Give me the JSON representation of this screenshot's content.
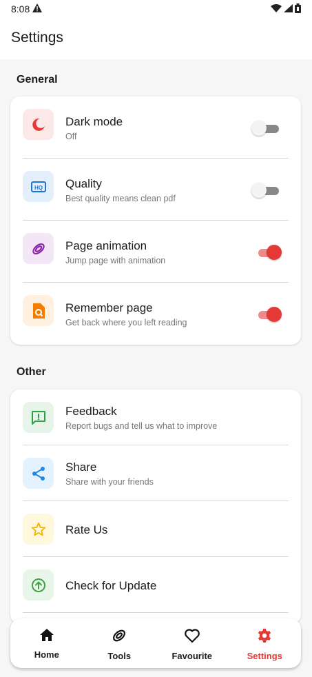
{
  "status": {
    "time": "8:08"
  },
  "header": {
    "title": "Settings"
  },
  "general": {
    "title": "General",
    "items": [
      {
        "label": "Dark mode",
        "subtitle": "Off",
        "icon": "moon-icon",
        "icon_color": "#e53935",
        "icon_bg": "#fde8e8",
        "toggle": false
      },
      {
        "label": "Quality",
        "subtitle": "Best quality means clean pdf",
        "icon": "hq-icon",
        "icon_color": "#1e73d8",
        "icon_bg": "#e3f0fc",
        "toggle": false
      },
      {
        "label": "Page animation",
        "subtitle": "Jump page with animation",
        "icon": "rings-icon",
        "icon_color": "#8e24aa",
        "icon_bg": "#f3e6f6",
        "toggle": true
      },
      {
        "label": "Remember page",
        "subtitle": "Get back where you left reading",
        "icon": "file-search-icon",
        "icon_color": "#f57c00",
        "icon_bg": "#fff0e0",
        "toggle": true
      }
    ]
  },
  "other": {
    "title": "Other",
    "items": [
      {
        "label": "Feedback",
        "subtitle": "Report bugs and tell us what to improve",
        "icon": "feedback-icon",
        "icon_color": "#2e9e48",
        "icon_bg": "#e6f4ea"
      },
      {
        "label": "Share",
        "subtitle": "Share with your friends",
        "icon": "share-icon",
        "icon_color": "#1e88e5",
        "icon_bg": "#e3f2fd"
      },
      {
        "label": "Rate Us",
        "subtitle": "",
        "icon": "star-icon",
        "icon_color": "#f4b400",
        "icon_bg": "#fff8dc"
      },
      {
        "label": "Check for Update",
        "subtitle": "",
        "icon": "update-icon",
        "icon_color": "#43a047",
        "icon_bg": "#e8f5e9"
      }
    ]
  },
  "nav": {
    "items": [
      {
        "label": "Home",
        "icon": "home-icon"
      },
      {
        "label": "Tools",
        "icon": "rings-icon"
      },
      {
        "label": "Favourite",
        "icon": "heart-icon"
      },
      {
        "label": "Settings",
        "icon": "gear-icon",
        "active": true
      }
    ],
    "active_color": "#e53935"
  }
}
